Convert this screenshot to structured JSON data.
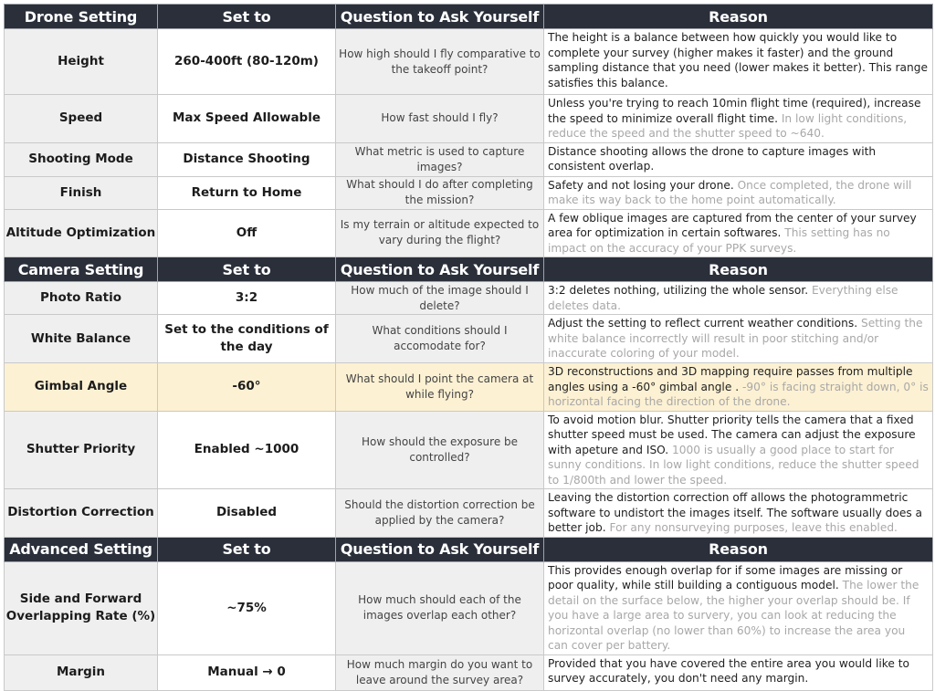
{
  "sections": [
    {
      "headers": [
        "Drone Setting",
        "Set to",
        "Question to Ask Yourself",
        "Reason"
      ],
      "rows": [
        {
          "setting": "Height",
          "value": "260-400ft (80-120m)",
          "question": "How high should I fly comparative to the takeoff point?",
          "reason": "The height is a balance between how quickly you would like to complete your survey (higher makes it faster) and the ground sampling distance that you need (lower makes it better). This range satisfies this balance.",
          "reason_muted": ""
        },
        {
          "setting": "Speed",
          "value": "Max Speed Allowable",
          "question": "How fast should I fly?",
          "reason": "Unless you're trying to reach 10min flight time (required), increase the speed to minimize overall flight time. ",
          "reason_muted": "In low light conditions, reduce the speed and the shutter speed to ~640."
        },
        {
          "setting": "Shooting Mode",
          "value": "Distance Shooting",
          "question": "What metric is used to capture images?",
          "reason": "Distance shooting allows the drone to capture images with consistent overlap.",
          "reason_muted": ""
        },
        {
          "setting": "Finish",
          "value": "Return to Home",
          "question": "What should I do after completing the mission?",
          "reason": "Safety and not losing your drone. ",
          "reason_muted": "Once completed, the drone will make its way back to the home point automatically."
        },
        {
          "setting": "Altitude Optimization",
          "value": "Off",
          "question": "Is my terrain or altitude expected to vary during the flight?",
          "reason": "A few oblique images are captured from the center of your survey area for optimization in certain softwares. ",
          "reason_muted": "This setting has no impact on the accuracy of your PPK surveys."
        }
      ]
    },
    {
      "headers": [
        "Camera Setting",
        "Set to",
        "Question to Ask Yourself",
        "Reason"
      ],
      "rows": [
        {
          "setting": "Photo Ratio",
          "value": "3:2",
          "question": "How much of the image should I delete?",
          "reason": "3:2 deletes nothing, utilizing the whole sensor. ",
          "reason_muted": "Everything else deletes data."
        },
        {
          "setting": "White Balance",
          "value": "Set to the conditions of the day",
          "question": "What conditions should I accomodate for?",
          "reason": "Adjust the setting to reflect current weather conditions. ",
          "reason_muted": "Setting the white balance incorrectly will result in poor stitching and/or inaccurate coloring of your model."
        },
        {
          "setting": "Gimbal Angle",
          "value": "-60°",
          "question": "What should I point the camera at while flying?",
          "reason": "3D reconstructions and 3D mapping require passes from multiple angles using a -60° gimbal angle . ",
          "reason_muted": "-90° is facing straight down, 0° is horizontal facing the direction of the drone.",
          "highlighted": true
        },
        {
          "setting": "Shutter Priority",
          "value": "Enabled ~1000",
          "question": "How should the exposure be controlled?",
          "reason": "To avoid motion blur. Shutter priority tells the camera that a fixed shutter speed must be used. The camera can adjust the exposure with apeture and ISO. ",
          "reason_muted": "1000 is usually a good place to start for sunny conditions. In low light conditions, reduce the shutter speed to 1/800th and lower the speed."
        },
        {
          "setting": "Distortion Correction",
          "value": "Disabled",
          "question": "Should the distortion correction be applied by the camera?",
          "reason": "Leaving the distortion correction off allows the photogrammetric software to undistort the images itself. The software usually does a better job. ",
          "reason_muted": "For any nonsurveying purposes, leave this enabled."
        }
      ]
    },
    {
      "headers": [
        "Advanced Setting",
        "Set to",
        "Question to Ask Yourself",
        "Reason"
      ],
      "rows": [
        {
          "setting": "Side and Forward Overlapping Rate (%)",
          "value": "~75%",
          "question": "How much should each of the images overlap each other?",
          "reason": "This provides enough overlap for if some images are missing or poor quality, while still building a contiguous model. ",
          "reason_muted": "The lower the detail on the surface below, the higher your overlap should be. If you have a large area to survery, you can look at reducing the horizontal overlap (no lower than 60%) to increase the area you can cover per battery."
        },
        {
          "setting": "Margin",
          "value": "Manual → 0",
          "question": "How much margin do you want to leave around the survey area?",
          "reason": "Provided that you have covered the entire area you would like to survey accurately, you don't need any margin.",
          "reason_muted": ""
        }
      ]
    }
  ],
  "colors": {
    "header_bg": "#2a2f3a",
    "header_text": "#ffffff",
    "cell_gray": "#efefef",
    "highlight": "#fdf1d3",
    "muted_text": "#a8a8a8"
  }
}
